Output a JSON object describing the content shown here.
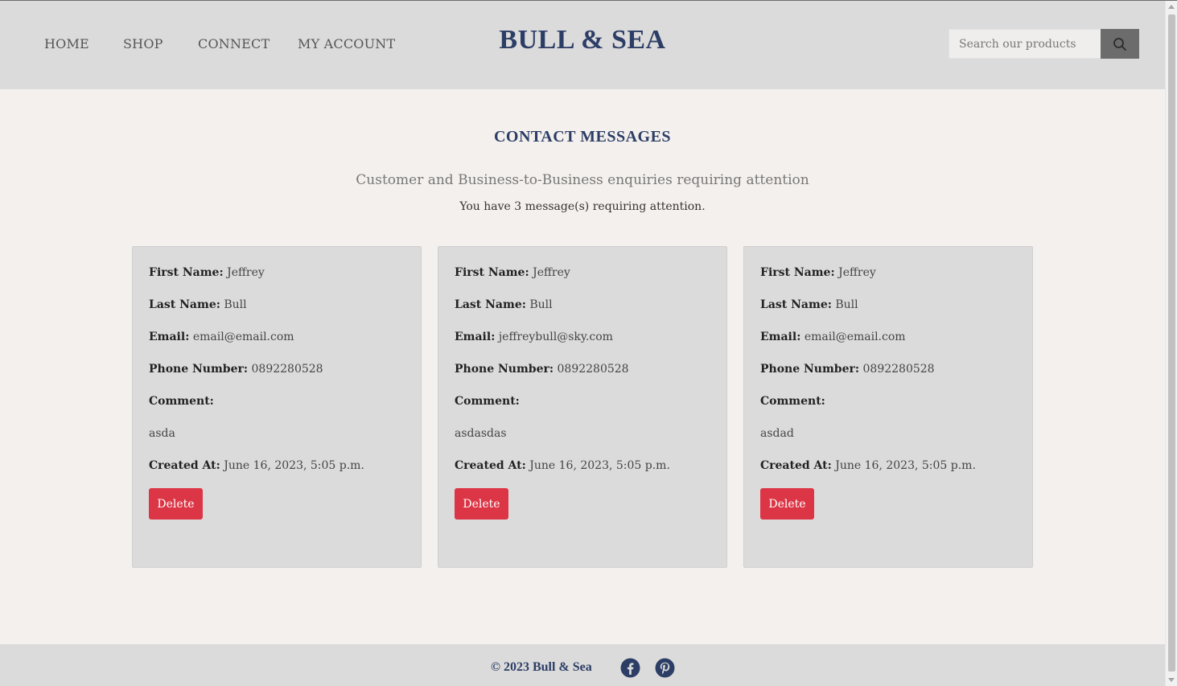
{
  "nav": {
    "home": "HOME",
    "shop": "SHOP",
    "connect": "CONNECT",
    "account": "MY ACCOUNT"
  },
  "brand": "BULL & SEA",
  "search": {
    "placeholder": "Search our products",
    "icon": "search-icon"
  },
  "main": {
    "title": "CONTACT MESSAGES",
    "subtitle": "Customer and Business-to-Business enquiries requiring attention",
    "count_text": "You have 3 message(s) requiring attention."
  },
  "labels": {
    "first_name": "First Name:",
    "last_name": "Last Name:",
    "email": "Email:",
    "phone": "Phone Number:",
    "comment": "Comment:",
    "created": "Created At:",
    "delete": "Delete"
  },
  "messages": [
    {
      "first_name": "Jeffrey",
      "last_name": "Bull",
      "email": "email@email.com",
      "phone": "0892280528",
      "comment": "asda",
      "created": "June 16, 2023, 5:05 p.m."
    },
    {
      "first_name": "Jeffrey",
      "last_name": "Bull",
      "email": "jeffreybull@sky.com",
      "phone": "0892280528",
      "comment": "asdasdas",
      "created": "June 16, 2023, 5:05 p.m."
    },
    {
      "first_name": "Jeffrey",
      "last_name": "Bull",
      "email": "email@email.com",
      "phone": "0892280528",
      "comment": "asdad",
      "created": "June 16, 2023, 5:05 p.m."
    }
  ],
  "footer": {
    "copyright": "© 2023 Bull & Sea",
    "social": [
      "facebook-icon",
      "pinterest-icon"
    ]
  },
  "colors": {
    "brand": "#2c3e66",
    "header_bg": "#dcdbdb",
    "page_bg": "#f4f0ed",
    "danger": "#dc3545"
  }
}
